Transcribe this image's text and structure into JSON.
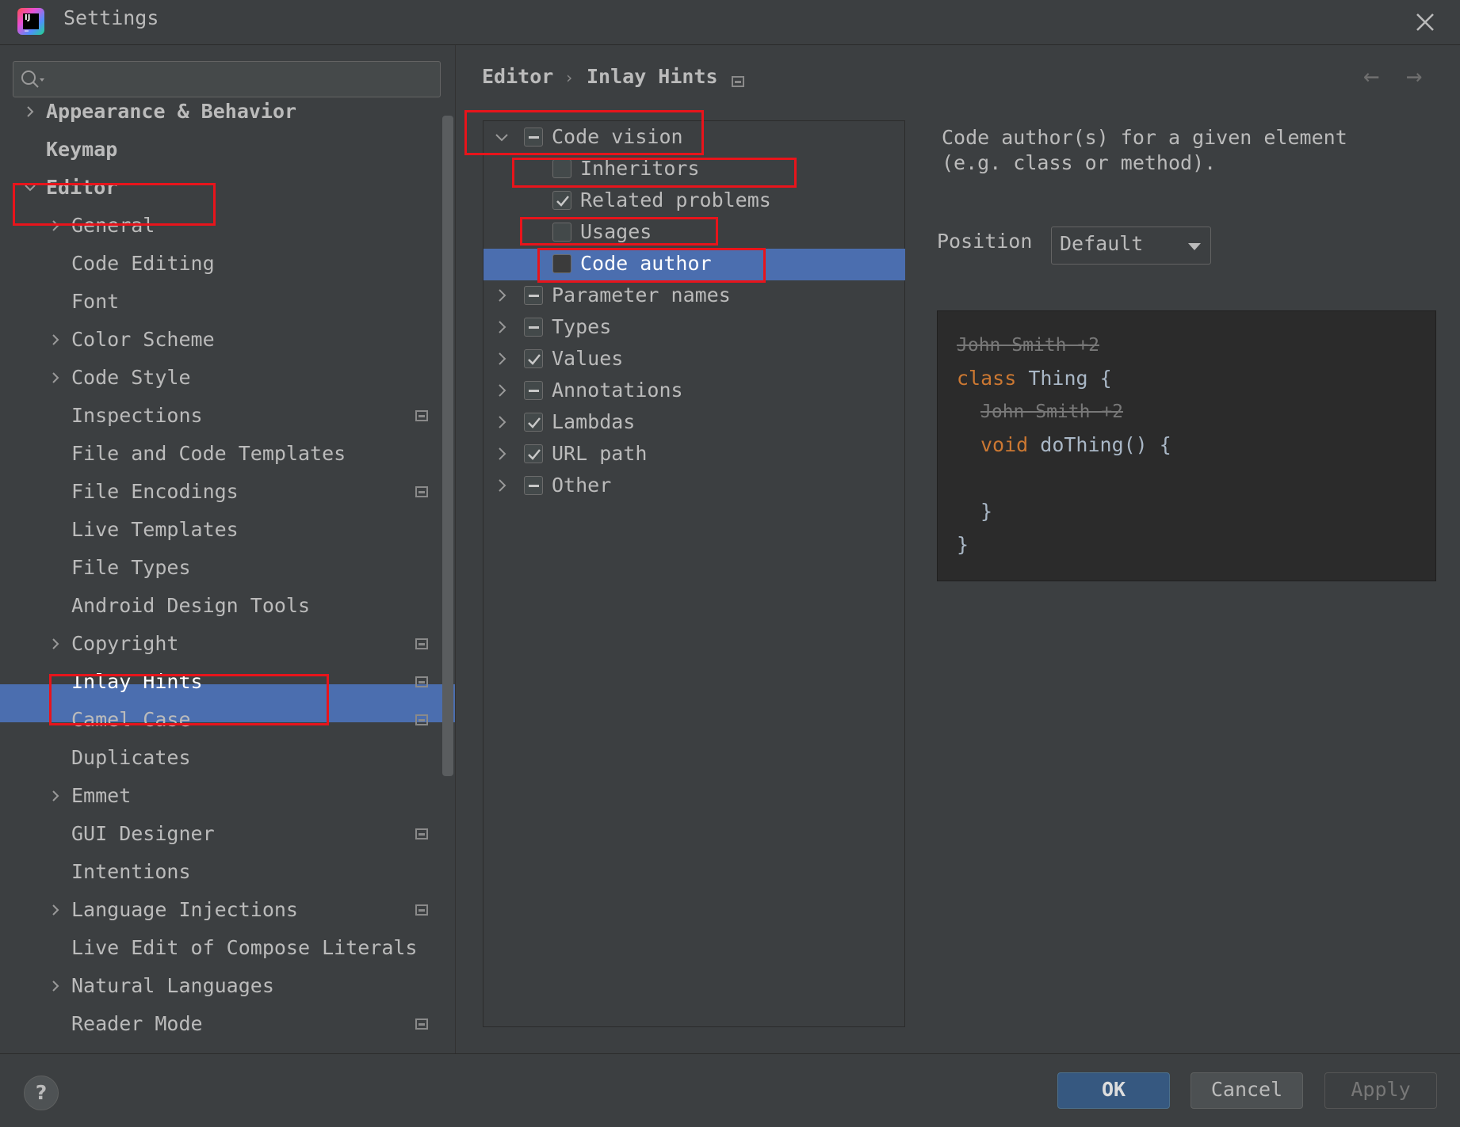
{
  "window": {
    "title": "Settings"
  },
  "search": {
    "placeholder": ""
  },
  "sidebar": {
    "items": [
      {
        "label": "Appearance & Behavior",
        "expandable": true
      },
      {
        "label": "Keymap",
        "expandable": false
      },
      {
        "label": "Editor",
        "expandable": true,
        "expanded": true
      },
      {
        "label": "General",
        "expandable": true
      },
      {
        "label": "Code Editing"
      },
      {
        "label": "Font"
      },
      {
        "label": "Color Scheme",
        "expandable": true
      },
      {
        "label": "Code Style",
        "expandable": true
      },
      {
        "label": "Inspections",
        "project_icon": true
      },
      {
        "label": "File and Code Templates"
      },
      {
        "label": "File Encodings",
        "project_icon": true
      },
      {
        "label": "Live Templates"
      },
      {
        "label": "File Types"
      },
      {
        "label": "Android Design Tools"
      },
      {
        "label": "Copyright",
        "expandable": true,
        "project_icon": true
      },
      {
        "label": "Inlay Hints",
        "selected": true,
        "project_icon": true
      },
      {
        "label": "Camel Case",
        "project_icon": true
      },
      {
        "label": "Duplicates"
      },
      {
        "label": "Emmet",
        "expandable": true
      },
      {
        "label": "GUI Designer",
        "project_icon": true
      },
      {
        "label": "Intentions"
      },
      {
        "label": "Language Injections",
        "expandable": true,
        "project_icon": true
      },
      {
        "label": "Live Edit of Compose Literals"
      },
      {
        "label": "Natural Languages",
        "expandable": true
      },
      {
        "label": "Reader Mode",
        "project_icon": true
      }
    ]
  },
  "breadcrumb": {
    "parent": "Editor",
    "separator": "›",
    "current": "Inlay Hints"
  },
  "hints": {
    "items": [
      {
        "label": "Code vision",
        "state": "partial",
        "expanded": true
      },
      {
        "label": "Inheritors",
        "state": "unchecked"
      },
      {
        "label": "Related problems",
        "state": "checked"
      },
      {
        "label": "Usages",
        "state": "unchecked"
      },
      {
        "label": "Code author",
        "state": "unchecked",
        "selected": true
      },
      {
        "label": "Parameter names",
        "state": "partial"
      },
      {
        "label": "Types",
        "state": "partial"
      },
      {
        "label": "Values",
        "state": "checked"
      },
      {
        "label": "Annotations",
        "state": "partial"
      },
      {
        "label": "Lambdas",
        "state": "checked"
      },
      {
        "label": "URL path",
        "state": "checked"
      },
      {
        "label": "Other",
        "state": "partial"
      }
    ]
  },
  "details": {
    "description": "Code author(s) for a given element (e.g. class or method).",
    "position_label": "Position",
    "position_value": "Default"
  },
  "preview": {
    "hint1": "John Smith +2",
    "line1_kw": "class",
    "line1_rest": " Thing {",
    "hint2": "John Smith +2",
    "line2_kw": "void",
    "line2_rest": " doThing() {",
    "line3": "}",
    "line4": "}"
  },
  "buttons": {
    "help": "?",
    "ok": "OK",
    "cancel": "Cancel",
    "apply": "Apply"
  },
  "colors": {
    "selection": "#4b6eaf",
    "annotation": "#e8141b",
    "keyword": "#cc7832"
  }
}
